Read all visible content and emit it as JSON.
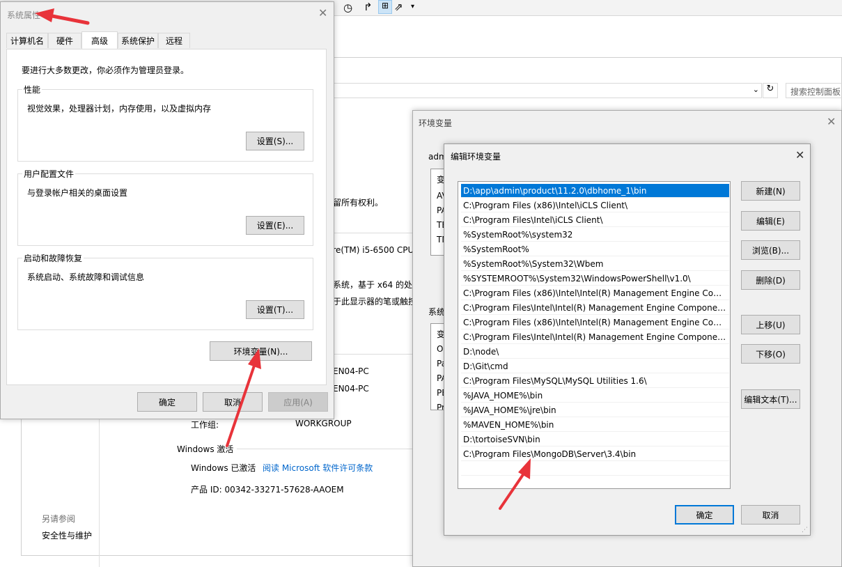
{
  "background_app": {
    "search_placeholder": "搜索控制面板",
    "rights_text": "留所有权利。",
    "cpu_text": "ore(TM) i5-6500 CPU",
    "system_type_text": "系统，基于 x64 的处",
    "pen_text": "于此显示器的笔或触控",
    "computer_name_1": "EN04-PC",
    "computer_name_2": "EN04-PC",
    "workgroup_label": "工作组:",
    "workgroup_value": "WORKGROUP",
    "activation_heading": "Windows 激活",
    "activation_status": "Windows 已激活",
    "license_link": "阅读 Microsoft 软件许可条款",
    "product_id": "产品 ID: 00342-33271-57628-AAOEM",
    "see_also": "另请参阅",
    "security_link": "安全性与维护"
  },
  "system_properties": {
    "title": "系统属性",
    "tabs": [
      "计算机名",
      "硬件",
      "高级",
      "系统保护",
      "远程"
    ],
    "admin_note": "要进行大多数更改，你必须作为管理员登录。",
    "performance": {
      "legend": "性能",
      "desc": "视觉效果，处理器计划，内存使用，以及虚拟内存",
      "button": "设置(S)..."
    },
    "user_profiles": {
      "legend": "用户配置文件",
      "desc": "与登录帐户相关的桌面设置",
      "button": "设置(E)..."
    },
    "startup_recovery": {
      "legend": "启动和故障恢复",
      "desc": "系统启动、系统故障和调试信息",
      "button": "设置(T)..."
    },
    "env_button": "环境变量(N)...",
    "ok": "确定",
    "cancel": "取消",
    "apply": "应用(A)"
  },
  "env_vars": {
    "title": "环境变量",
    "user_group_fragment": "adm",
    "user_rows_fragment": [
      "变",
      "AV",
      "PA",
      "TE",
      "TM"
    ],
    "system_group_fragment": "系统",
    "system_rows_fragment": [
      "变",
      "Ol",
      "Pa",
      "PA",
      "PE",
      "Pr"
    ]
  },
  "edit_env": {
    "title": "编辑环境变量",
    "paths": [
      "D:\\app\\admin\\product\\11.2.0\\dbhome_1\\bin",
      "C:\\Program Files (x86)\\Intel\\iCLS Client\\",
      "C:\\Program Files\\Intel\\iCLS Client\\",
      "%SystemRoot%\\system32",
      "%SystemRoot%",
      "%SystemRoot%\\System32\\Wbem",
      "%SYSTEMROOT%\\System32\\WindowsPowerShell\\v1.0\\",
      "C:\\Program Files (x86)\\Intel\\Intel(R) Management Engine Comp...",
      "C:\\Program Files\\Intel\\Intel(R) Management Engine Component...",
      "C:\\Program Files (x86)\\Intel\\Intel(R) Management Engine Comp...",
      "C:\\Program Files\\Intel\\Intel(R) Management Engine Component...",
      "D:\\node\\",
      "D:\\Git\\cmd",
      "C:\\Program Files\\MySQL\\MySQL Utilities 1.6\\",
      "%JAVA_HOME%\\bin",
      "%JAVA_HOME%\\jre\\bin",
      "%MAVEN_HOME%\\bin",
      "D:\\tortoiseSVN\\bin",
      "C:\\Program Files\\MongoDB\\Server\\3.4\\bin"
    ],
    "buttons": {
      "new": "新建(N)",
      "edit": "编辑(E)",
      "browse": "浏览(B)...",
      "delete": "删除(D)",
      "move_up": "上移(U)",
      "move_down": "下移(O)",
      "edit_text": "编辑文本(T)...",
      "ok": "确定",
      "cancel": "取消"
    }
  },
  "colors": {
    "annotation_arrow": "#e8333a",
    "selection": "#0078d7",
    "link": "#0066cc"
  }
}
